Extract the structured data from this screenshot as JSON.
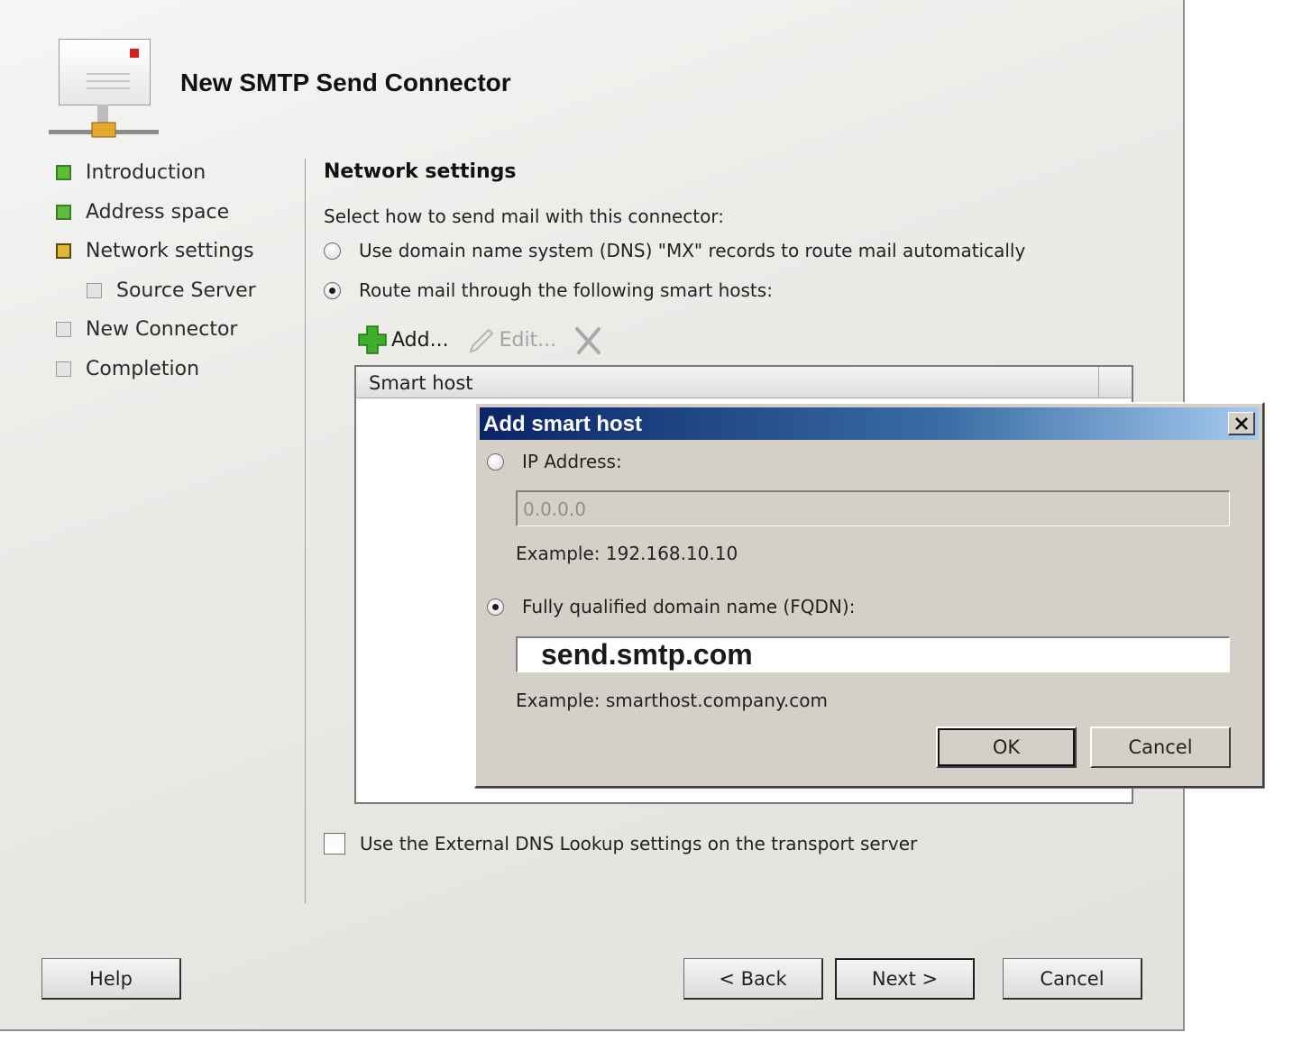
{
  "window": {
    "title": "New SMTP Send Connector"
  },
  "steps": [
    {
      "label": "Introduction",
      "status": "done"
    },
    {
      "label": "Address space",
      "status": "done"
    },
    {
      "label": "Network settings",
      "status": "current"
    },
    {
      "label": "Source Server",
      "status": "pending"
    },
    {
      "label": "New Connector",
      "status": "pending"
    },
    {
      "label": "Completion",
      "status": "pending"
    }
  ],
  "section": {
    "title": "Network settings",
    "instruction": "Select how to send mail with this connector:",
    "option_dns": "Use domain name system (DNS) \"MX\" records to route mail automatically",
    "option_smart": "Route mail through the following smart hosts:"
  },
  "toolbar": {
    "add": "Add...",
    "edit": "Edit..."
  },
  "list": {
    "column": "Smart host"
  },
  "dns_checkbox": "Use the External DNS Lookup settings on the transport server",
  "buttons": {
    "help": "Help",
    "back": "< Back",
    "next": "Next >",
    "cancel": "Cancel"
  },
  "dialog": {
    "title": "Add smart host",
    "ip_label": "IP Address:",
    "ip_value": "0.0.0.0",
    "ip_example": "Example: 192.168.10.10",
    "fqdn_label": "Fully qualified domain name (FQDN):",
    "fqdn_value": "send.smtp.com",
    "fqdn_example": "Example: smarthost.company.com",
    "ok": "OK",
    "cancel": "Cancel"
  },
  "colors": {
    "step_done": "#5bbd3a",
    "step_current": "#e0b733",
    "titlebar_start": "#0a246a",
    "add_icon": "#3fae2a"
  },
  "icons": [
    "connector-icon",
    "add-icon",
    "edit-icon",
    "delete-icon",
    "close-icon"
  ]
}
